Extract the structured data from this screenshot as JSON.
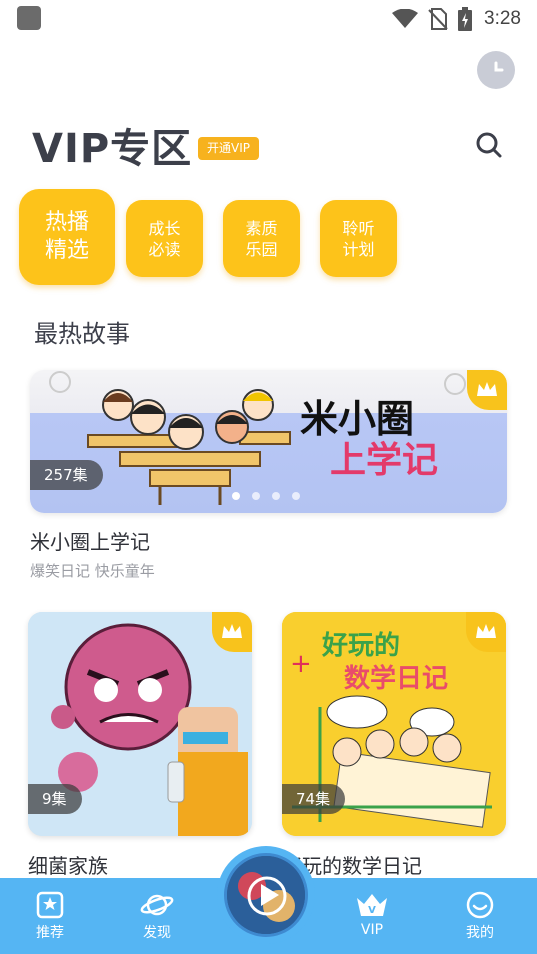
{
  "status_bar": {
    "time": "3:28"
  },
  "header": {
    "title": "VIP专区",
    "vip_badge": "开通VIP"
  },
  "categories": [
    {
      "label": "热播\n精选",
      "active": true
    },
    {
      "label": "成长\n必读",
      "active": false
    },
    {
      "label": "素质\n乐园",
      "active": false
    },
    {
      "label": "聆听\n计划",
      "active": false
    }
  ],
  "section": {
    "title": "最热故事"
  },
  "banner": {
    "episode_count": "257集",
    "story_title": "米小圈上学记",
    "story_subtitle": "爆笑日记 快乐童年",
    "artwork_text_line1": "米小圈",
    "artwork_text_line2": "上学记",
    "dot_count": 4,
    "active_dot": 0
  },
  "grid": [
    {
      "episode_count": "9集",
      "title": "细菌家族"
    },
    {
      "episode_count": "74集",
      "title": "好玩的数学日记",
      "artwork_text_line1": "好玩的",
      "artwork_text_line2": "数学日记"
    }
  ],
  "bottom_nav": [
    {
      "label": "推荐",
      "icon": "star-card-icon"
    },
    {
      "label": "发现",
      "icon": "planet-icon"
    },
    {
      "label": "",
      "icon": "play-icon"
    },
    {
      "label": "VIP",
      "icon": "crown-v-icon"
    },
    {
      "label": "我的",
      "icon": "smile-icon"
    }
  ],
  "colors": {
    "accent": "#fdc31a",
    "nav": "#55b5f3",
    "title": "#3c3f4a"
  }
}
